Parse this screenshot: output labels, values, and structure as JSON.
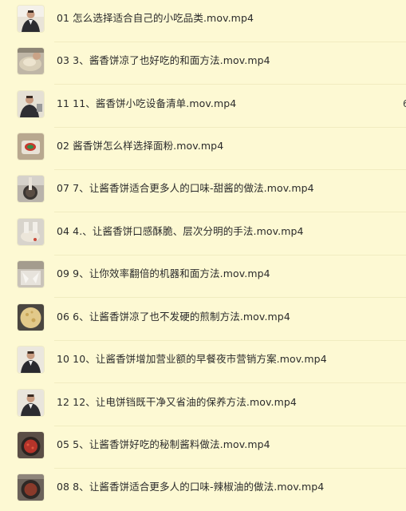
{
  "files": [
    {
      "name": "01 怎么选择适合自己的小吃品类.mov.mp4",
      "thumb": "man-icon",
      "edge": ""
    },
    {
      "name": "03 3、酱香饼凉了也好吃的和面方法.mov.mp4",
      "thumb": "dough-icon",
      "edge": ""
    },
    {
      "name": "11 11、酱香饼小吃设备清单.mov.mp4",
      "thumb": "man-icon",
      "edge": "6"
    },
    {
      "name": "02 酱香饼怎么样选择面粉.mov.mp4",
      "thumb": "flour-bag-icon",
      "edge": ""
    },
    {
      "name": "07 7、让酱香饼适合更多人的口味-甜酱的做法.mov.mp4",
      "thumb": "sauce-pot-icon",
      "edge": ""
    },
    {
      "name": "04 4.、让酱香饼口感酥脆、层次分明的手法.mov.mp4",
      "thumb": "kneading-icon",
      "edge": ""
    },
    {
      "name": "09 9、让你效率翻倍的机器和面方法.mov.mp4",
      "thumb": "machine-icon",
      "edge": ""
    },
    {
      "name": "06 6、让酱香饼凉了也不发硬的煎制方法.mov.mp4",
      "thumb": "pancake-icon",
      "edge": ""
    },
    {
      "name": "10 10、让酱香饼增加营业额的早餐夜市营销方案.mov.mp4",
      "thumb": "man-icon",
      "edge": ""
    },
    {
      "name": "12 12、让电饼铛既干净又省油的保养方法.mov.mp4",
      "thumb": "man-icon",
      "edge": ""
    },
    {
      "name": "05 5、让酱香饼好吃的秘制酱料做法.mov.mp4",
      "thumb": "chili-sauce-icon",
      "edge": ""
    },
    {
      "name": "08 8、让酱香饼适合更多人的口味-辣椒油的做法.mov.mp4",
      "thumb": "chili-oil-icon",
      "edge": ""
    }
  ]
}
